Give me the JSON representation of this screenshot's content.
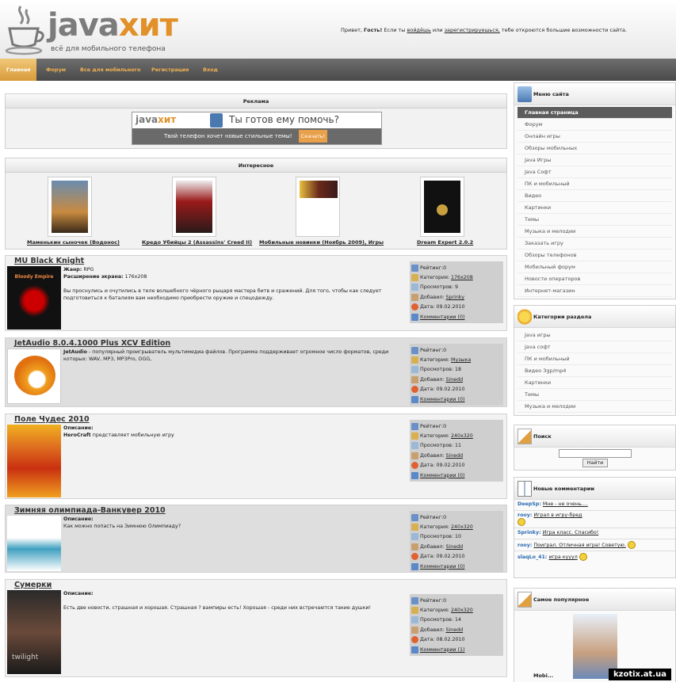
{
  "header": {
    "logo_word_1": "java",
    "logo_word_2": "хит",
    "logo_subtitle": "всё для мобильного телефона",
    "welcome_prefix": "Привет,",
    "welcome_guest": "Гость!",
    "welcome_mid1": "Если ты",
    "welcome_login": "войдёшь",
    "welcome_mid2": "или",
    "welcome_register": "зарегистрируешься,",
    "welcome_suffix": "тебе откроются большие возможности сайта."
  },
  "nav": {
    "items": [
      "Главная",
      "Форум",
      "Все для мобильного",
      "Регистрация",
      "Вход"
    ],
    "active_index": 0
  },
  "ad": {
    "heading": "Реклама",
    "banner_logo_1": "java",
    "banner_logo_2": "хит",
    "banner_title": "Ты готов ему помочь?",
    "banner_text": "Твой телефон хочет новые стильные темы!",
    "banner_button": "Скачать!"
  },
  "interesting": {
    "heading": "Интересное",
    "items": [
      "Маменькин сыночек (Водонос)",
      "Кредо Убийцы 2 (Assassins' Creed II)",
      "Мобильные новинки (Ноябрь 2009), Игры",
      "Dream Expert 2.0.2"
    ]
  },
  "meta_labels": {
    "rating": "Рейтинг:",
    "category": "Категория:",
    "views": "Просмотров:",
    "added": "Добавил:",
    "date": "Дата:",
    "comments": "Комментарии"
  },
  "entries": [
    {
      "title": "MU Black Knight",
      "desc_b1": "Жанр:",
      "desc_t1": "RPG",
      "desc_b2": "Расширение экрана:",
      "desc_t2": "176x208",
      "desc_body": "Вы проснулись и очутились в теле волшебного чёрного рыцаря мастера битв и сражений. Для того, чтобы как следует подготовиться к баталиям вам необходимо приобрести оружие и спецодежду.",
      "rating": "0",
      "category": "176x208",
      "views": "9",
      "added": "Sprinky",
      "date": "09.02.2010",
      "comments": "(0)"
    },
    {
      "title": "JetAudio 8.0.4.1000 Plus XCV Edition",
      "desc_b1": "JetAudio",
      "desc_t1": "- популярный проигрыватель мультимедиа файлов. Программа поддерживает огромное число форматов, среди которых: WAV, MP3, MP3Pro, OGG,",
      "desc_b2": "",
      "desc_t2": "",
      "desc_body": "",
      "rating": "0",
      "category": "Музыка",
      "views": "18",
      "added": "Sinedd",
      "date": "09.02.2010",
      "comments": "(0)"
    },
    {
      "title": "Поле Чудес 2010",
      "desc_b1": "Описание:",
      "desc_t1": "",
      "desc_b2": "HeroCraft",
      "desc_t2": "представляет мобильную игру",
      "desc_body": "",
      "rating": "0",
      "category": "240x320",
      "views": "11",
      "added": "Sinedd",
      "date": "09.02.2010",
      "comments": "(0)"
    },
    {
      "title": "Зимняя олимпиада-Ванкувер 2010",
      "desc_b1": "Описание:",
      "desc_t1": "",
      "desc_b2": "",
      "desc_t2": "Как можно попасть на Зимнюю Олимпиаду?",
      "desc_body": "",
      "rating": "0",
      "category": "240x320",
      "views": "10",
      "added": "Sinedd",
      "date": "09.02.2010",
      "comments": "(0)"
    },
    {
      "title": "Сумерки",
      "desc_b1": "Описание:",
      "desc_t1": "",
      "desc_b2": "",
      "desc_t2": "",
      "desc_body": "Есть две новости, страшная и хорошая. Страшная ? вампиры есть! Хорошая - среди них встречаются такие душки!",
      "rating": "0",
      "category": "240x320",
      "views": "14",
      "added": "Sinedd",
      "date": "08.02.2010",
      "comments": "(1)"
    }
  ],
  "sidebar": {
    "menu_title": "Меню сайта",
    "menu_items": [
      "Главная страница",
      "Форум",
      "Онлайн игры",
      "Обзоры мобильных",
      "Java Игры",
      "Java Софт",
      "ПК и мобильный",
      "Видео",
      "Картинки",
      "Темы",
      "Музыка и мелодии",
      "Заказать игру",
      "Обзоры телефонов",
      "Мобильный форум",
      "Новости операторов",
      "Интернет-магазин"
    ],
    "menu_active": 0,
    "cat_title": "Категории раздела",
    "cat_items": [
      "Java игры",
      "Java софт",
      "ПК и мобильный",
      "Видео 3gp/mp4",
      "Картинки",
      "Темы",
      "Музыка и мелодии"
    ],
    "search_title": "Поиск",
    "search_button": "Найти",
    "comments_title": "Новые комментарии",
    "comments": [
      {
        "user": "DeepSp:",
        "text": "Мне - не очень....",
        "smile": false
      },
      {
        "user": "rooy:",
        "text": "Играл в игру-бред",
        "smile": true
      },
      {
        "user": "Sprinky:",
        "text": "Игра класс. Спасибо!",
        "smile": false
      },
      {
        "user": "rooy:",
        "text": "Поиграл. Отличная игра! Советую.",
        "smile": true
      },
      {
        "user": "slaqLo_41:",
        "text": "игра кууул",
        "smile": true
      }
    ],
    "popular_title": "Самое популярное",
    "popular_caption": "Mobi..."
  },
  "watermark": "kzotix.at.ua",
  "colors": {
    "accent": "#e2912a",
    "nav_bg": "#555555",
    "link_blue": "#2a6ab0"
  }
}
